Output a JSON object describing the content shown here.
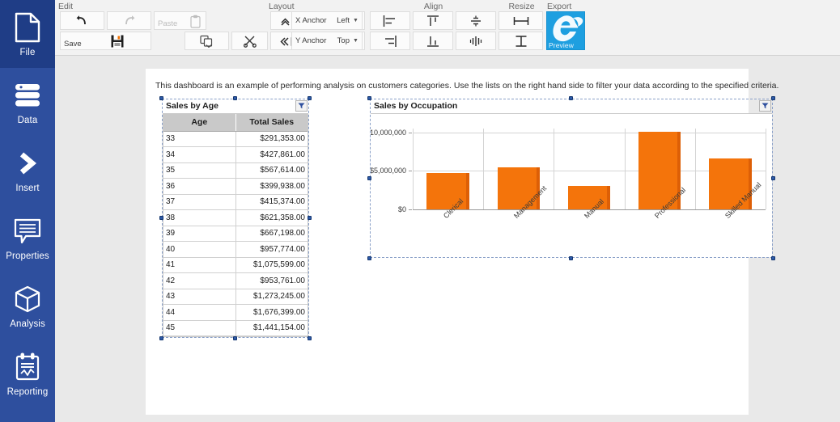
{
  "sidebar": {
    "items": [
      {
        "label": "File",
        "icon": "file-icon",
        "active": true
      },
      {
        "label": "Data",
        "icon": "database-icon",
        "active": false
      },
      {
        "label": "Insert",
        "icon": "chevron-right-icon",
        "active": false
      },
      {
        "label": "Properties",
        "icon": "comment-lines-icon",
        "active": false
      },
      {
        "label": "Analysis",
        "icon": "cube-icon",
        "active": false
      },
      {
        "label": "Reporting",
        "icon": "clipboard-chart-icon",
        "active": false
      }
    ]
  },
  "toolbar": {
    "groups": {
      "edit": "Edit",
      "layout": "Layout",
      "align": "Align",
      "resize": "Resize",
      "export": "Export"
    },
    "edit": {
      "undo_label": "",
      "undo_icon": "undo-arrow-icon",
      "redo_label": "",
      "redo_icon": "redo-arrow-icon",
      "paste_label": "Paste",
      "paste_icon": "clipboard-icon",
      "save_label": "Save",
      "save_icon": "floppy-disk-icon",
      "copy_icon": "copy-pages-icon",
      "cut_icon": "scissors-icon"
    },
    "layout": {
      "bring_icon": "move-vertical-icon",
      "send_icon": "move-horizontal-icon",
      "dock_right_icon": "dock-right-icon",
      "dock_top_icon": "dock-top-icon"
    },
    "anchors": {
      "x_label": "X Anchor",
      "x_value": "Left",
      "y_label": "Y Anchor",
      "y_value": "Top"
    },
    "align": {
      "align_left_icon": "align-left-icon",
      "align_top_icon": "align-top-icon",
      "distribute_vertical_icon": "distribute-vertical-icon",
      "align_right_icon": "align-right-icon",
      "align_bottom_icon": "align-bottom-icon",
      "distribute_horizontal_icon": "distribute-horizontal-icon"
    },
    "resize": {
      "same_width_icon": "same-width-icon",
      "same_height_icon": "same-height-icon"
    },
    "export": {
      "preview_label": "Preview",
      "preview_icon": "internet-explorer-icon",
      "accent_color": "#1e9fe0"
    }
  },
  "page": {
    "description": "This dashboard is an example of performing analysis on customers categories. Use the lists on the right hand side to filter your data according to the specified criteria."
  },
  "table_widget": {
    "title": "Sales by Age",
    "filter_icon": "filter-funnel-icon",
    "columns": [
      "Age",
      "Total Sales"
    ],
    "rows": [
      [
        "33",
        "$291,353.00"
      ],
      [
        "34",
        "$427,861.00"
      ],
      [
        "35",
        "$567,614.00"
      ],
      [
        "36",
        "$399,938.00"
      ],
      [
        "37",
        "$415,374.00"
      ],
      [
        "38",
        "$621,358.00"
      ],
      [
        "39",
        "$667,198.00"
      ],
      [
        "40",
        "$957,774.00"
      ],
      [
        "41",
        "$1,075,599.00"
      ],
      [
        "42",
        "$953,761.00"
      ],
      [
        "43",
        "$1,273,245.00"
      ],
      [
        "44",
        "$1,676,399.00"
      ],
      [
        "45",
        "$1,441,154.00"
      ]
    ]
  },
  "chart_widget": {
    "title": "Sales by Occupation",
    "filter_icon": "filter-funnel-icon"
  },
  "chart_data": {
    "type": "bar",
    "title": "Sales by Occupation",
    "xlabel": "",
    "ylabel": "",
    "categories": [
      "Clerical",
      "Management",
      "Manual",
      "Professional",
      "Skilled Manual"
    ],
    "values": [
      4750000,
      5450000,
      3000000,
      10100000,
      6600000
    ],
    "ylim": [
      0,
      10500000
    ],
    "yticks": [
      0,
      5000000,
      10000000
    ],
    "ytick_labels": [
      "$0",
      "$5,000,000",
      "$10,000,000"
    ],
    "bar_color": "#f4740b",
    "bar_shadow_color": "#dd5f06",
    "grid": true,
    "legend": false
  }
}
